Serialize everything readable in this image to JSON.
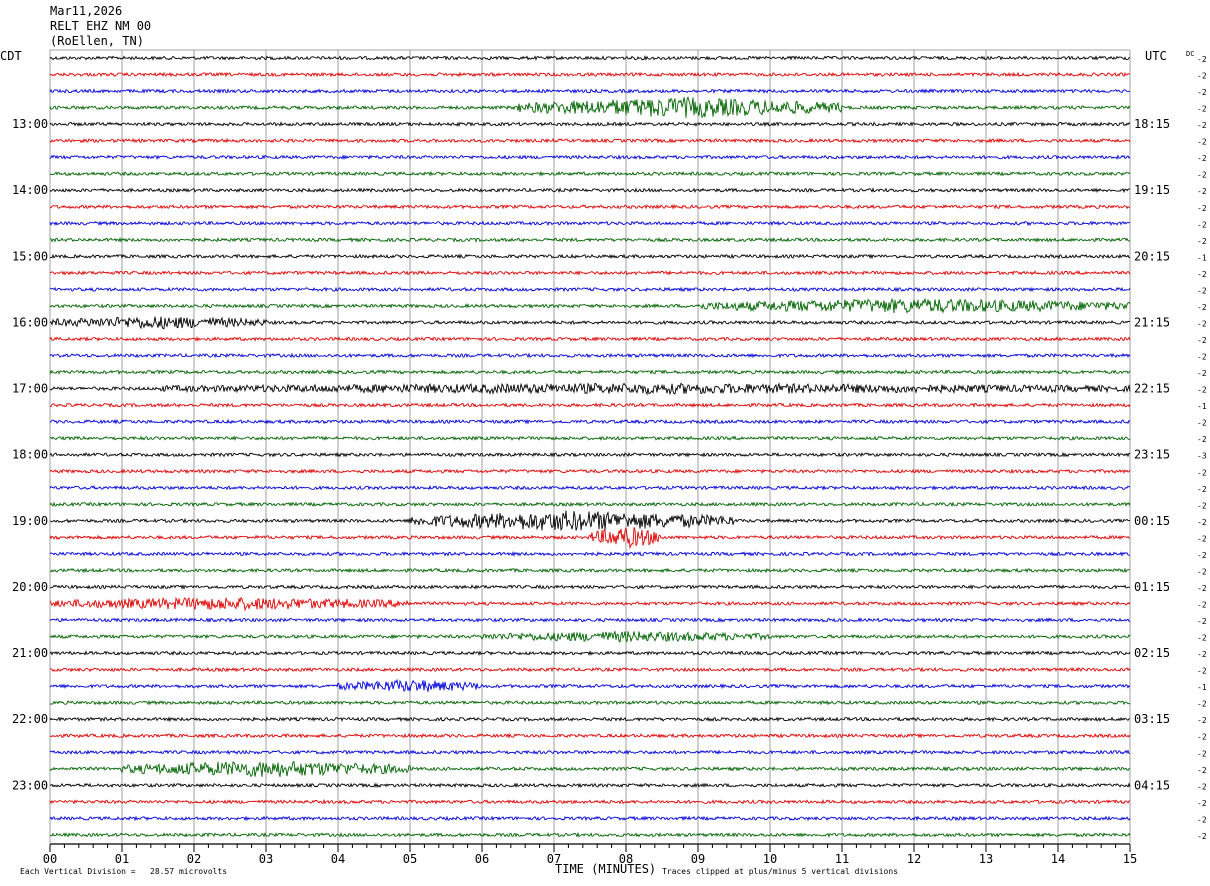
{
  "header": {
    "date": "Mar11,2026",
    "station": "RELT EHZ NM 00",
    "location": "(RoEllen, TN)"
  },
  "left_tz": "CDT",
  "right_tz": "UTC",
  "dc_label": "DC",
  "footer": {
    "scale_note": "Each Vertical Division =   28.57 microvolts",
    "xlabel": "TIME (MINUTES)",
    "clip_note": "Traces clipped at plus/minus 5 vertical divisions"
  },
  "colors": {
    "black": "#000000",
    "red": "#e00000",
    "blue": "#0000dd",
    "green": "#006400",
    "grid": "#888888"
  },
  "chart_data": {
    "type": "line",
    "title": "RELT EHZ NM 00",
    "xlabel": "TIME (MINUTES)",
    "xlim": [
      0,
      15
    ],
    "x_ticks": [
      "00",
      "01",
      "02",
      "03",
      "04",
      "05",
      "06",
      "07",
      "08",
      "09",
      "10",
      "11",
      "12",
      "13",
      "14",
      "15"
    ],
    "rows_per_hour": 4,
    "row_minutes": 15,
    "trace_color_cycle": [
      "black",
      "red",
      "blue",
      "green"
    ],
    "left_hour_labels": [
      "13:00",
      "14:00",
      "15:00",
      "16:00",
      "17:00",
      "18:00",
      "19:00",
      "20:00",
      "21:00",
      "22:00",
      "23:00"
    ],
    "right_hour_labels": [
      "18:15",
      "19:15",
      "20:15",
      "21:15",
      "22:15",
      "23:15",
      "00:15",
      "01:15",
      "02:15",
      "03:15",
      "04:15"
    ],
    "dc_offsets": [
      -2,
      -2,
      -2,
      -2,
      -2,
      -2,
      -2,
      -2,
      -2,
      -2,
      -2,
      -2,
      -1,
      -2,
      -2,
      -2,
      -2,
      -2,
      -2,
      -2,
      -2,
      -1,
      -2,
      -2,
      -3,
      -2,
      -2,
      -2,
      -2,
      -2,
      -2,
      -2,
      -2,
      -2,
      -2,
      -2,
      -2,
      -2,
      -1,
      -2,
      -2,
      -2,
      -2,
      -2,
      -2,
      -2,
      -2,
      -2
    ],
    "scale_microvolts_per_division": 28.57,
    "clip_divisions": 5,
    "events": [
      {
        "row": 3,
        "start_min": 6.5,
        "end_min": 11.0,
        "amp": 9
      },
      {
        "row": 15,
        "start_min": 9.0,
        "end_min": 15.0,
        "amp": 6
      },
      {
        "row": 16,
        "start_min": 0.0,
        "end_min": 3.0,
        "amp": 5
      },
      {
        "row": 20,
        "start_min": 1.5,
        "end_min": 15.0,
        "amp": 4
      },
      {
        "row": 28,
        "start_min": 5.0,
        "end_min": 9.5,
        "amp": 9
      },
      {
        "row": 29,
        "start_min": 7.5,
        "end_min": 8.5,
        "amp": 10
      },
      {
        "row": 33,
        "start_min": 0.0,
        "end_min": 5.0,
        "amp": 5
      },
      {
        "row": 35,
        "start_min": 6.0,
        "end_min": 10.0,
        "amp": 4
      },
      {
        "row": 38,
        "start_min": 4.0,
        "end_min": 6.0,
        "amp": 5
      },
      {
        "row": 43,
        "start_min": 1.0,
        "end_min": 5.0,
        "amp": 7
      }
    ]
  }
}
